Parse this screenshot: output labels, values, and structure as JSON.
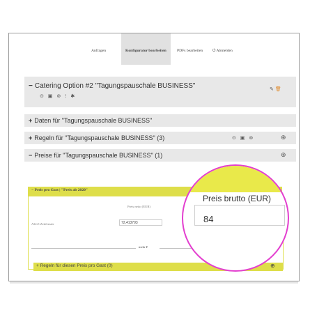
{
  "nav": {
    "anfragen": "Anfragen",
    "konfigurator": "Konfigurator bearbeiten",
    "pdfs": "PDFs bearbeiten",
    "abmelden": "Abmelden"
  },
  "catering": {
    "symbol": "−",
    "title": "Catering Option #2 \"Tagungspauschale BUSINESS\"",
    "icons": "⊙ ▣ ⊚ ⁝ ✱",
    "right_icons": "⬋ 🗑"
  },
  "daten": {
    "symbol": "+",
    "title": "Daten für \"Tagungspauschale BUSINESS\""
  },
  "regeln": {
    "symbol": "+",
    "title": "Regeln für \"Tagungspauschale BUSINESS\" (3)",
    "icons": "⊙ ▣ ⊚",
    "right": "⊕"
  },
  "preise": {
    "symbol": "−",
    "title": "Preise für \"Tagungspauschale BUSINESS\" (1)",
    "right": "⊕"
  },
  "preis_gast": {
    "header": "− Preis pro Gast | \"Preis ab 2020\"",
    "preis_netto_label": "Preis netto (EUR)",
    "alle_label": "ALLE Zeitfenster",
    "netto_value": "72,413793",
    "mehr": "mehr ▾",
    "regeln_footer": "+ Regeln für diesen Preis pro Gast (0)",
    "footer_right": "⊕"
  },
  "magnifier": {
    "label": "Preis brutto (EUR)",
    "value": "84"
  },
  "colors": {
    "yellow": "#dede4a",
    "highlight": "#e33fcf",
    "accent": "#e08b2c"
  }
}
